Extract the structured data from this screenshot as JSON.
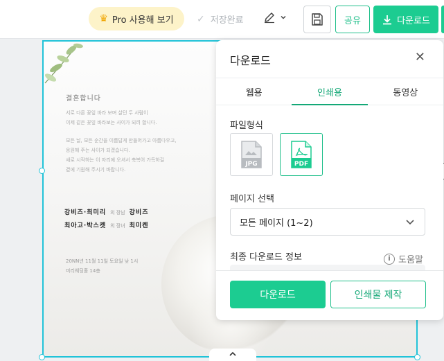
{
  "toolbar": {
    "pro_label": "Pro 사용해 보기",
    "saved_label": "저장완료",
    "share_label": "공유",
    "download_label": "다운로드"
  },
  "invitation": {
    "title": "결혼합니다",
    "lines1": [
      "서로 다른 꽃잎 바라 보며 살던 두 사람이",
      "이제 같은 꽃잎 바라보는 사이가 되려 합니다."
    ],
    "lines2": [
      "모든 날, 모든 순간을 이름답게 만들어가고 아름다우고,",
      "응원해 주는 사이가 되겠습니다.",
      "새로 시작하는 이 자리에 오셔서 축복어 가득하길",
      "곁에 기원해 주시기 바랍니다."
    ],
    "groom_parents": "강비즈·최미리",
    "groom_rel": "의 장남",
    "groom": "강비즈",
    "bride_parents": "최아고·박스켓",
    "bride_rel": "의 장녀",
    "bride": "최미켄",
    "date_line1": "20NN년 11월 11일 토요일 낮 1시",
    "date_line2": "미리웨딩홀 14층"
  },
  "panel": {
    "title": "다운로드",
    "tabs": [
      "웹용",
      "인쇄용",
      "동영상"
    ],
    "active_tab": "인쇄용",
    "format_label": "파일형식",
    "formats": [
      "JPG",
      "PDF"
    ],
    "selected_format": "PDF",
    "page_select_label": "페이지 선택",
    "page_select_value": "모든 페이지 (1~2)",
    "final_info_label": "최종 다운로드 정보",
    "help_label": "도움말",
    "download_button": "다운로드",
    "print_button": "인쇄물 제작"
  },
  "colors": {
    "accent": "#1ccc91",
    "accent_text": "#14a877",
    "selection": "#21c3d8",
    "pro_bg": "#fdf3c9"
  },
  "icons": {
    "pro": "crown-icon",
    "saved": "check-icon",
    "pen": "pen-icon",
    "save": "save-disk-icon",
    "download": "download-arrow-icon",
    "close": "close-icon",
    "help": "info-icon",
    "dropdown": "chevron-down-icon",
    "collapse": "chevron-up-icon"
  }
}
